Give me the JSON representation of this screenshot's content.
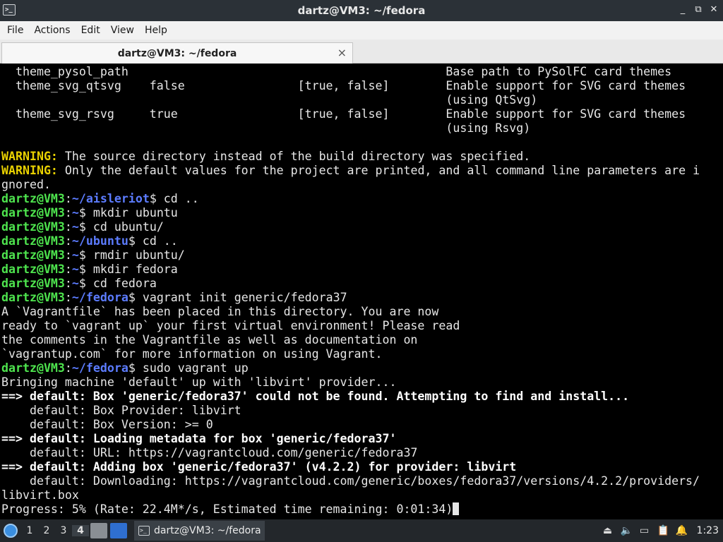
{
  "window": {
    "title": "dartz@VM3: ~/fedora",
    "controls": [
      "_",
      "⧉",
      "✕"
    ]
  },
  "menu": [
    "File",
    "Actions",
    "Edit",
    "View",
    "Help"
  ],
  "tab": {
    "label": "dartz@VM3: ~/fedora",
    "close": "×"
  },
  "terminal": {
    "user": "dartz@VM3",
    "options": [
      {
        "name": "theme_pysol_path",
        "value": "",
        "choices": "",
        "desc": "Base path to PySolFC card themes"
      },
      {
        "name": "theme_svg_qtsvg",
        "value": "false",
        "choices": "[true, false]",
        "desc": "Enable support for SVG card themes"
      },
      {
        "name": "",
        "value": "",
        "choices": "",
        "desc": "(using QtSvg)"
      },
      {
        "name": "theme_svg_rsvg",
        "value": "true",
        "choices": "[true, false]",
        "desc": "Enable support for SVG card themes"
      },
      {
        "name": "",
        "value": "",
        "choices": "",
        "desc": "(using Rsvg)"
      }
    ],
    "warning_label": "WARNING:",
    "warning1": " The source directory instead of the build directory was specified.",
    "warning2": " Only the default values for the project are printed, and all command line parameters are i",
    "warning2_cont": "gnored.",
    "commands": [
      {
        "path": "~/aisleriot",
        "cmd": "$ cd .."
      },
      {
        "path": "~",
        "cmd": "$ mkdir ubuntu"
      },
      {
        "path": "~",
        "cmd": "$ cd ubuntu/"
      },
      {
        "path": "~/ubuntu",
        "cmd": "$ cd .."
      },
      {
        "path": "~",
        "cmd": "$ rmdir ubuntu/"
      },
      {
        "path": "~",
        "cmd": "$ mkdir fedora"
      },
      {
        "path": "~",
        "cmd": "$ cd fedora"
      },
      {
        "path": "~/fedora",
        "cmd": "$ vagrant init generic/fedora37"
      }
    ],
    "init_output": [
      "A `Vagrantfile` has been placed in this directory. You are now",
      "ready to `vagrant up` your first virtual environment! Please read",
      "the comments in the Vagrantfile as well as documentation on",
      "`vagrantup.com` for more information on using Vagrant."
    ],
    "up_command": {
      "path": "~/fedora",
      "cmd": "$ sudo vagrant up"
    },
    "up_output": [
      {
        "text": "Bringing machine 'default' up with 'libvirt' provider...",
        "bold": false
      },
      {
        "text": "==> default: Box 'generic/fedora37' could not be found. Attempting to find and install...",
        "bold": true
      },
      {
        "text": "    default: Box Provider: libvirt",
        "bold": false
      },
      {
        "text": "    default: Box Version: >= 0",
        "bold": false
      },
      {
        "text": "==> default: Loading metadata for box 'generic/fedora37'",
        "bold": true
      },
      {
        "text": "    default: URL: https://vagrantcloud.com/generic/fedora37",
        "bold": false
      },
      {
        "text": "==> default: Adding box 'generic/fedora37' (v4.2.2) for provider: libvirt",
        "bold": true
      },
      {
        "text": "    default: Downloading: https://vagrantcloud.com/generic/boxes/fedora37/versions/4.2.2/providers/",
        "bold": false
      },
      {
        "text": "libvirt.box",
        "bold": false
      }
    ],
    "progress": "Progress: 5% (Rate: 22.4M*/s, Estimated time remaining: 0:01:34)"
  },
  "taskbar": {
    "workspaces": [
      "1",
      "2",
      "3",
      "4"
    ],
    "active_workspace": "4",
    "task_label": "dartz@VM3: ~/fedora",
    "clock": "1:23"
  },
  "colors": {
    "prompt_user": "#4ee44e",
    "prompt_path": "#5c7cff",
    "warning": "#e8d000"
  }
}
